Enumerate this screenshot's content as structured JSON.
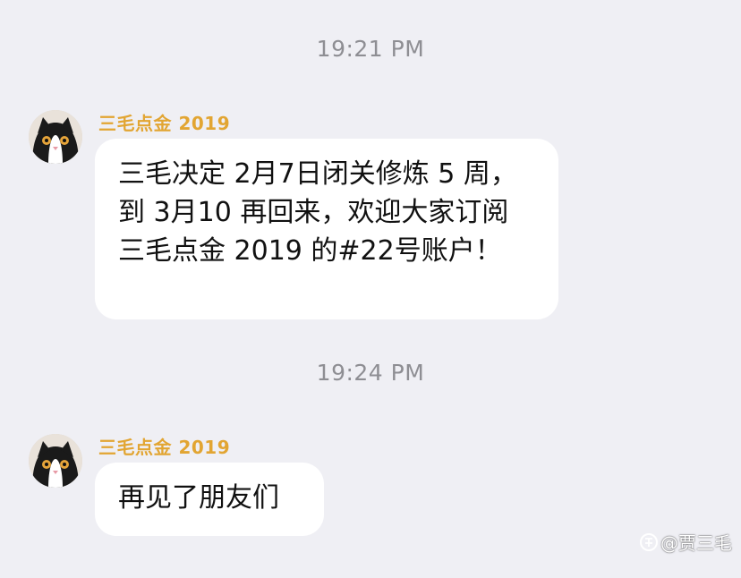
{
  "conversation": {
    "timestamps": [
      "19:21 PM",
      "19:24 PM"
    ],
    "messages": [
      {
        "sender": "三毛点金 2019",
        "avatar_icon": "cat-avatar-icon",
        "text": "三毛决定 2月7日闭关修炼 5 周，到 3月10 再回来，欢迎大家订阅 三毛点金 2019 的#22号账户！"
      },
      {
        "sender": "三毛点金 2019",
        "avatar_icon": "cat-avatar-icon",
        "text": "再见了朋友们"
      }
    ]
  },
  "watermark": {
    "text": "@贾三毛",
    "icon": "zhihu-logo-icon"
  },
  "colors": {
    "background": "#efeff4",
    "sender_name": "#e2a532",
    "timestamp": "#8e8e93",
    "bubble": "#ffffff",
    "message_text": "#111111"
  }
}
